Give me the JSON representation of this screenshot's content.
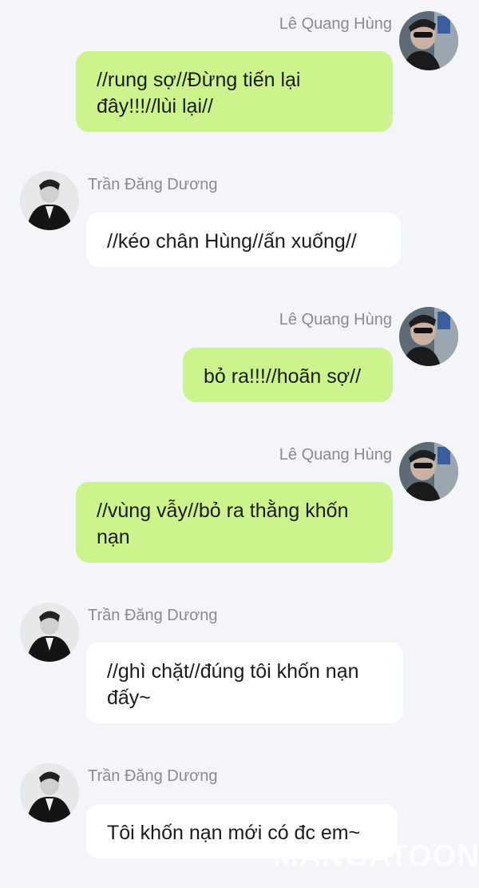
{
  "users": {
    "me": {
      "name": "Lê Quang Hùng",
      "bubble_color": "#cdf38f"
    },
    "other": {
      "name": "Trần Đăng Dương",
      "bubble_color": "#ffffff"
    }
  },
  "messages": [
    {
      "sender": "Lê Quang Hùng",
      "text": "//rung sợ//Đừng tiến lại đây!!!//lùi lại//"
    },
    {
      "sender": "Trần Đăng Dương",
      "text": "//kéo chân Hùng//ấn xuống//"
    },
    {
      "sender": "Lê Quang Hùng",
      "text": "bỏ ra!!!//hoãn sợ//"
    },
    {
      "sender": "Lê Quang Hùng",
      "text": "//vùng vẫy//bỏ ra thằng khốn nạn"
    },
    {
      "sender": "Trần Đăng Dương",
      "text": "//ghì chặt//đúng tôi khốn nạn đấy~"
    },
    {
      "sender": "Trần Đăng Dương",
      "text": "Tôi khốn nạn mới có đc em~"
    }
  ],
  "watermark": "MANGATOON"
}
